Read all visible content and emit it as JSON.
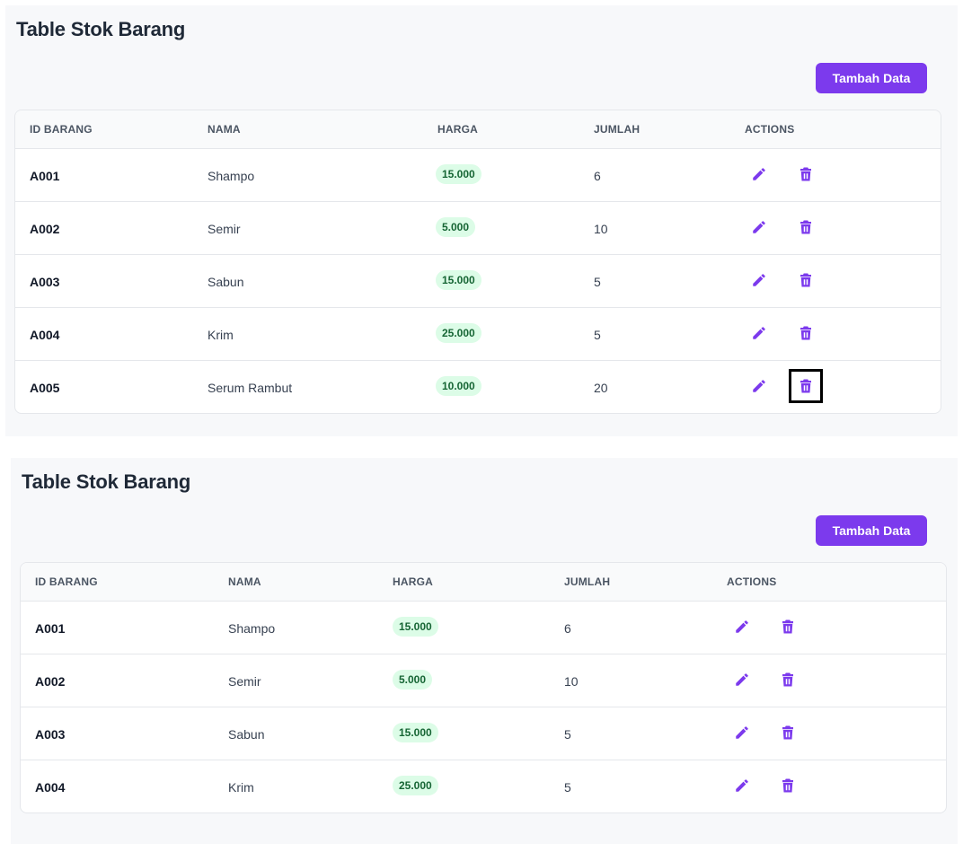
{
  "colors": {
    "accent": "#7c3aed",
    "pill_bg": "#dcfce7",
    "pill_text": "#166534",
    "panel_bg": "#f7f8fa"
  },
  "icons": {
    "edit": "pencil-icon",
    "delete": "trash-icon"
  },
  "panels": [
    {
      "title": "Table Stok Barang",
      "add_button_label": "Tambah Data",
      "columns": [
        "ID BARANG",
        "NAMA",
        "HARGA",
        "JUMLAH",
        "ACTIONS"
      ],
      "rows": [
        {
          "id": "A001",
          "nama": "Shampo",
          "harga": "15.000",
          "jumlah": "6"
        },
        {
          "id": "A002",
          "nama": "Semir",
          "harga": "5.000",
          "jumlah": "10"
        },
        {
          "id": "A003",
          "nama": "Sabun",
          "harga": "15.000",
          "jumlah": "5"
        },
        {
          "id": "A004",
          "nama": "Krim",
          "harga": "25.000",
          "jumlah": "5"
        },
        {
          "id": "A005",
          "nama": "Serum Rambut",
          "harga": "10.000",
          "jumlah": "20"
        }
      ]
    },
    {
      "title": "Table Stok Barang",
      "add_button_label": "Tambah Data",
      "columns": [
        "ID BARANG",
        "NAMA",
        "HARGA",
        "JUMLAH",
        "ACTIONS"
      ],
      "rows": [
        {
          "id": "A001",
          "nama": "Shampo",
          "harga": "15.000",
          "jumlah": "6"
        },
        {
          "id": "A002",
          "nama": "Semir",
          "harga": "5.000",
          "jumlah": "10"
        },
        {
          "id": "A003",
          "nama": "Sabun",
          "harga": "15.000",
          "jumlah": "5"
        },
        {
          "id": "A004",
          "nama": "Krim",
          "harga": "25.000",
          "jumlah": "5"
        }
      ]
    }
  ]
}
